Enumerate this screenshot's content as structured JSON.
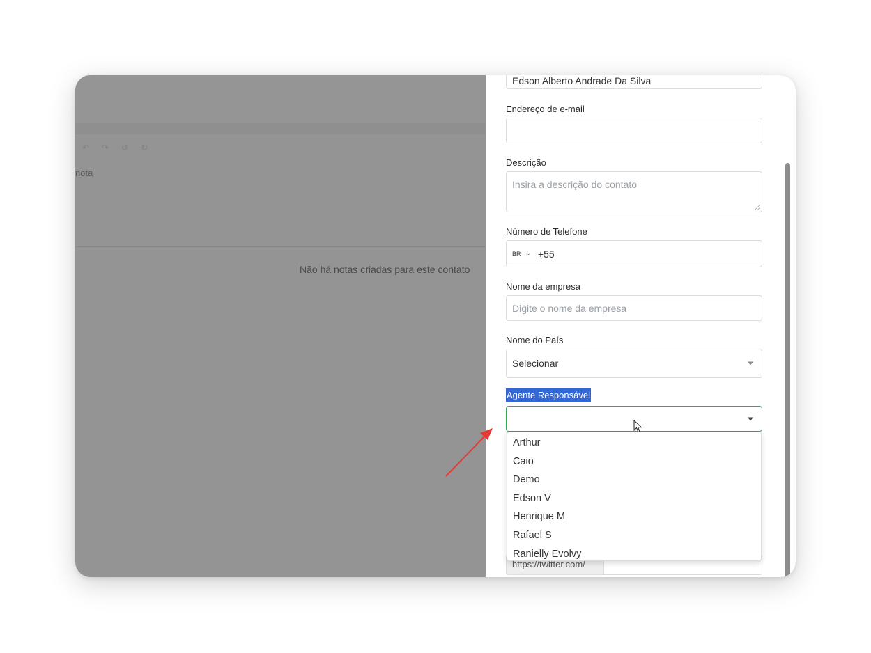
{
  "background": {
    "toolbar_icons": [
      "undo-icon",
      "redo-icon",
      "undo-icon",
      "redo-icon"
    ],
    "note_label": "nota",
    "empty_notes_text": "Não há notas criadas para este contato"
  },
  "form": {
    "name_value": "Edson Alberto Andrade Da Silva",
    "email_label": "Endereço de e-mail",
    "email_value": "",
    "description_label": "Descrição",
    "description_placeholder": "Insira a descrição do contato",
    "phone_label": "Número de Telefone",
    "phone_country": "BR",
    "phone_prefix": "+55",
    "company_label": "Nome da empresa",
    "company_placeholder": "Digite o nome da empresa",
    "country_label": "Nome do País",
    "country_value": "Selecionar",
    "agent_label": "Agente Responsável",
    "agent_value": "",
    "agent_options": [
      "Arthur",
      "Caio",
      "Demo",
      "Edson V",
      "Henrique M",
      "Rafael S",
      "Ranielly Evolvy"
    ],
    "twitter_prefix": "https://twitter.com/"
  },
  "colors": {
    "focus_border": "#34a853",
    "highlight": "#3367d6",
    "annotation_arrow": "#e53935"
  }
}
